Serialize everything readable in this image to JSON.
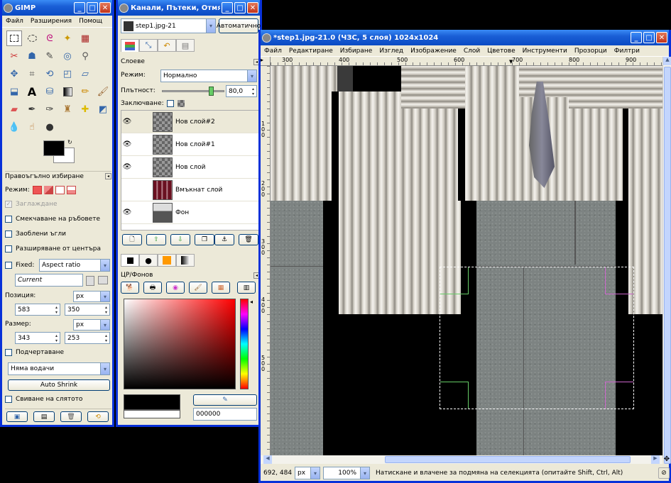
{
  "toolbox": {
    "title": "GIMP",
    "menu": [
      "Файл",
      "Разширения",
      "Помощ"
    ],
    "tool_options_title": "Правоъгълно избиране",
    "mode_label": "Режим:",
    "antialias_label": "Заглаждане",
    "feather_label": "Смекчаване на ръбовете",
    "rounded_label": "Заоблени ъгли",
    "expand_label": "Разширяване от центъра",
    "fixed_label": "Fixed:",
    "fixed_value": "Aspect ratio",
    "current_value": "Current",
    "position_label": "Позиция:",
    "position_unit": "px",
    "pos_x": "583",
    "pos_y": "350",
    "size_label": "Размер:",
    "size_unit": "px",
    "size_w": "343",
    "size_h": "253",
    "highlight_label": "Подчертаване",
    "guides_value": "Няма водачи",
    "autoshrink_label": "Auto Shrink",
    "shrink_merged_label": "Свиване на слятото"
  },
  "dock": {
    "title": "Канали, Пътеки, Отмя...",
    "image_select": "step1.jpg-21",
    "auto_button": "Автоматично",
    "layers_title": "Слоеве",
    "mode_label": "Режим:",
    "mode_value": "Нормално",
    "opacity_label": "Плътност:",
    "opacity_value": "80,0",
    "opacity_fraction": 0.8,
    "lock_label": "Заключване:",
    "layers": [
      {
        "name": "Нов слой#2",
        "visible": true,
        "selected": true
      },
      {
        "name": "Нов слой#1",
        "visible": true,
        "selected": false
      },
      {
        "name": "Нов слой",
        "visible": true,
        "selected": false
      },
      {
        "name": "Вмъкнат слой",
        "visible": false,
        "selected": false
      },
      {
        "name": "Фон",
        "visible": true,
        "selected": false
      }
    ],
    "fgbg_title": "ЦР/Фонов",
    "hex_value": "000000"
  },
  "image_window": {
    "title": "*step1.jpg-21.0 (ЧЗС, 5 слоя) 1024x1024",
    "menu": [
      "Файл",
      "Редактиране",
      "Избиране",
      "Изглед",
      "Изображение",
      "Слой",
      "Цветове",
      "Инструменти",
      "Прозорци",
      "Филтри"
    ],
    "ruler_labels": [
      "300",
      "400",
      "500",
      "600",
      "700",
      "800",
      "900"
    ],
    "vruler_labels": [
      "100",
      "200",
      "300",
      "400",
      "500"
    ],
    "coords": "692, 484",
    "unit": "px",
    "zoom": "100%",
    "status": "Натискане и влачене за подмяна на селекцията (опитайте Shift, Ctrl, Alt)"
  },
  "colors": {
    "titlebar": "#0a4ac4",
    "window_bg": "#ece9d8",
    "selection": "#ffffff"
  }
}
